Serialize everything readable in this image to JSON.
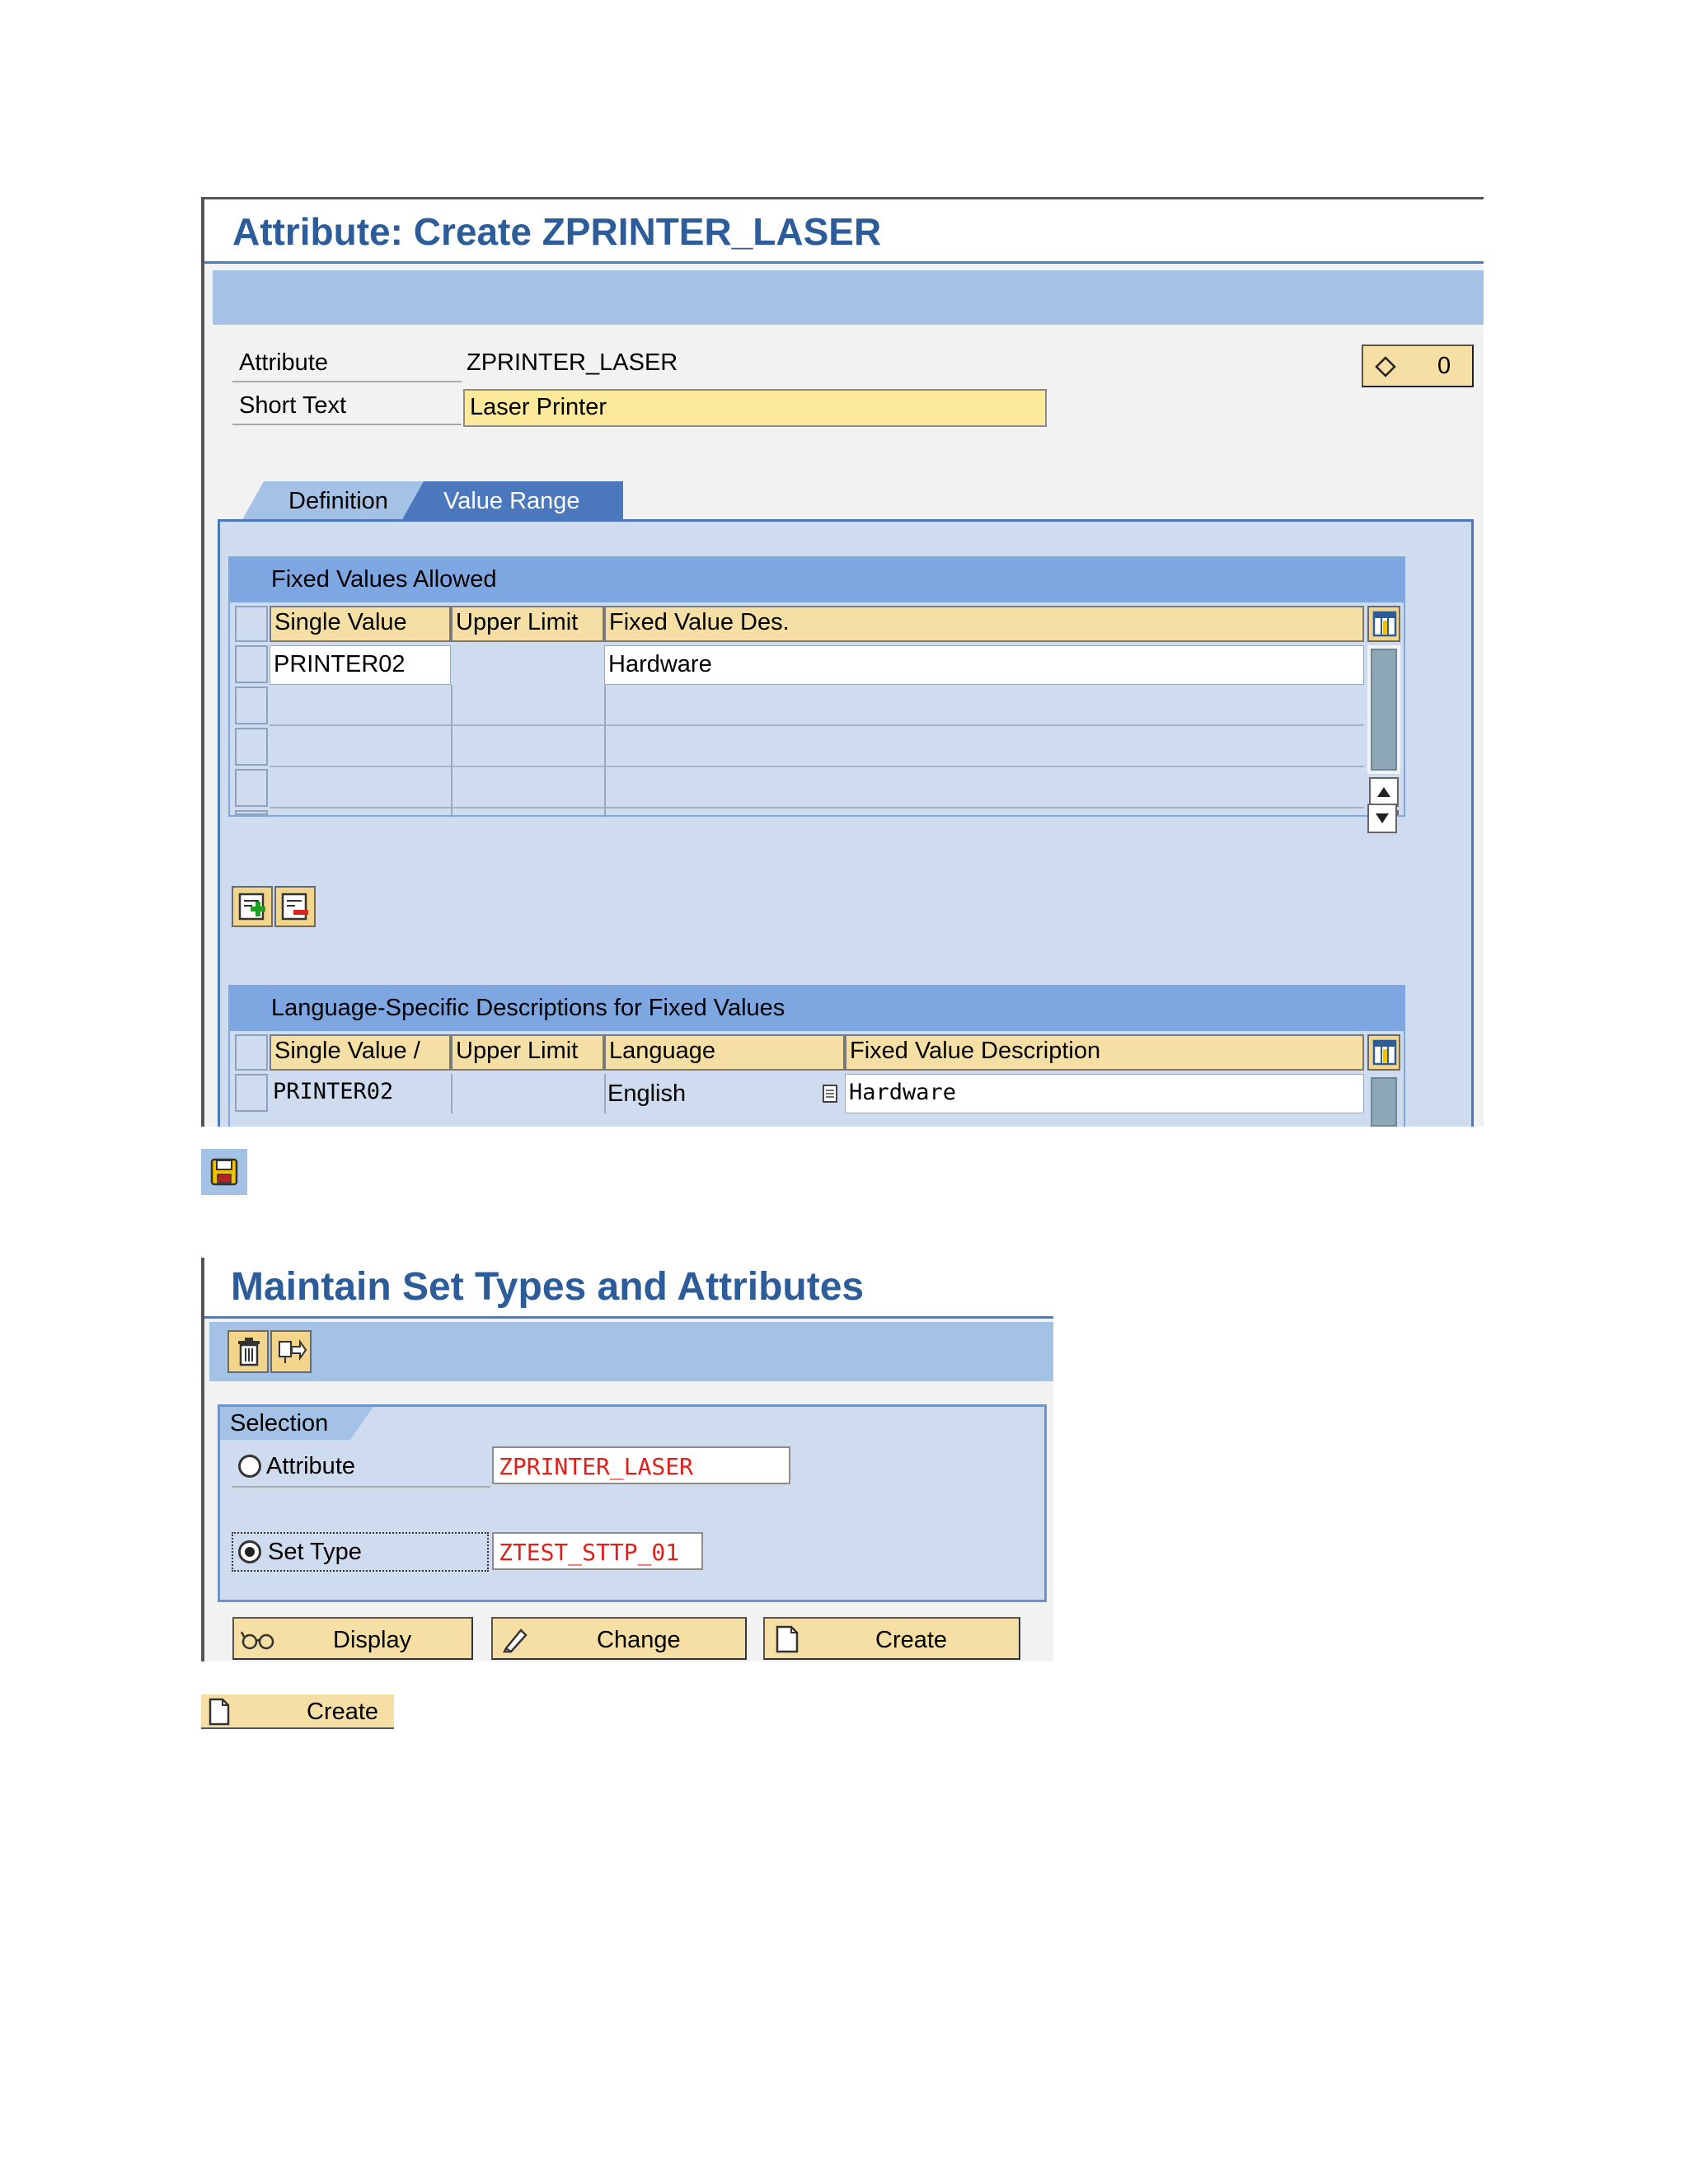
{
  "screen1": {
    "title": "Attribute: Create ZPRINTER_LASER",
    "attribute_label": "Attribute",
    "attribute_value": "ZPRINTER_LASER",
    "short_text_label": "Short Text",
    "short_text_value": "Laser Printer",
    "counter_value": "0",
    "tabs": [
      {
        "label": "Definition",
        "active": false
      },
      {
        "label": "Value Range",
        "active": true
      }
    ],
    "fixed_values": {
      "group_title": "Fixed Values Allowed",
      "columns": [
        "Single Value",
        "Upper Limit",
        "Fixed Value Des."
      ],
      "rows": [
        {
          "single_value": "PRINTER02",
          "upper_limit": "",
          "description": "Hardware"
        }
      ]
    },
    "lang_desc": {
      "group_title": "Language-Specific Descriptions for Fixed Values",
      "columns": [
        "Single Value /",
        "Upper Limit",
        "Language",
        "Fixed Value Description"
      ],
      "rows": [
        {
          "single_value": "PRINTER02",
          "upper_limit": "",
          "language": "English",
          "description": "Hardware"
        }
      ]
    }
  },
  "screen2": {
    "title": "Maintain Set Types and Attributes",
    "selection_label": "Selection",
    "attribute_option_label": "Attribute",
    "attribute_option_value": "ZPRINTER_LASER",
    "settype_option_label": "Set Type",
    "settype_option_value": "ZTEST_STTP_01",
    "selected_option": "Set Type",
    "buttons": {
      "display": "Display",
      "change": "Change",
      "create": "Create"
    }
  },
  "standalone_create_label": "Create",
  "icons": [
    "diamond-icon",
    "table-settings-icon",
    "scroll-up-icon",
    "scroll-down-icon",
    "insert-row-icon",
    "delete-row-icon",
    "save-icon",
    "trash-icon",
    "transport-icon",
    "glasses-icon",
    "pencil-icon",
    "new-document-icon",
    "f4-help-icon"
  ]
}
